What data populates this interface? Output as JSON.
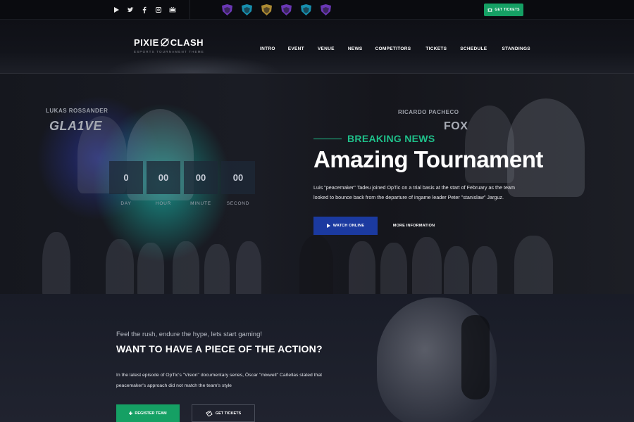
{
  "topbar": {
    "social": [
      "youtube-icon",
      "twitter-icon",
      "facebook-icon",
      "instagram-icon",
      "youtube-tv-icon"
    ],
    "teams": [
      {
        "icon": "team-logo-purple-icon",
        "color": "#7b3fd1"
      },
      {
        "icon": "team-logo-teal-icon",
        "color": "#1aa6c9"
      },
      {
        "icon": "team-logo-gold-icon",
        "color": "#c9a13a"
      },
      {
        "icon": "team-logo-purple-icon",
        "color": "#7b3fd1"
      },
      {
        "icon": "team-logo-teal-icon",
        "color": "#1aa6c9"
      },
      {
        "icon": "team-logo-purple-icon",
        "color": "#7b3fd1"
      }
    ],
    "get_tickets": "GET TICKETS"
  },
  "header": {
    "logo_left": "PIXIE",
    "logo_right": "CLASH",
    "logo_sub": "ESPORTS TOURNAMENT THEME",
    "nav": [
      "INTRO",
      "EVENT",
      "VENUE",
      "NEWS",
      "COMPETITORS",
      "TICKETS",
      "SCHEDULE",
      "STANDINGS"
    ]
  },
  "hero": {
    "player_left_name": "LUKAS ROSSANDER",
    "player_left_tag": "GLA1VE",
    "player_right_name": "RICARDO PACHECO",
    "player_right_tag": "FOX",
    "countdown": {
      "values": [
        "0",
        "00",
        "00",
        "00"
      ],
      "labels": [
        "DAY",
        "HOUR",
        "MINUTE",
        "SECOND"
      ]
    },
    "kicker": "BREAKING NEWS",
    "title": "Amazing Tournament",
    "text": "Luis \"peacemaker\" Tadeu joined OpTic on a trial basis at the start of February as the team looked to bounce back from the departure of ingame leader Peter \"stanislaw\" Jarguz.",
    "watch_label": "WATCH ONLINE",
    "more_label": "MORE INFORMATION"
  },
  "lower": {
    "tagline": "Feel the rush, endure the hype, lets start gaming!",
    "title": "WANT TO HAVE A PIECE OF THE ACTION?",
    "text": "In the latest episode of OpTic's \"Vision\" documentary series, Óscar \"mixwell\" Cañellas stated that peacemaker's approach did not match the team's style",
    "register_label": "REGISTER TEAM",
    "tickets_label": "GET TICKETS"
  },
  "colors": {
    "accent_green": "#15a064",
    "breaking_green": "#1fc08a",
    "button_blue": "#1b3aa0"
  }
}
